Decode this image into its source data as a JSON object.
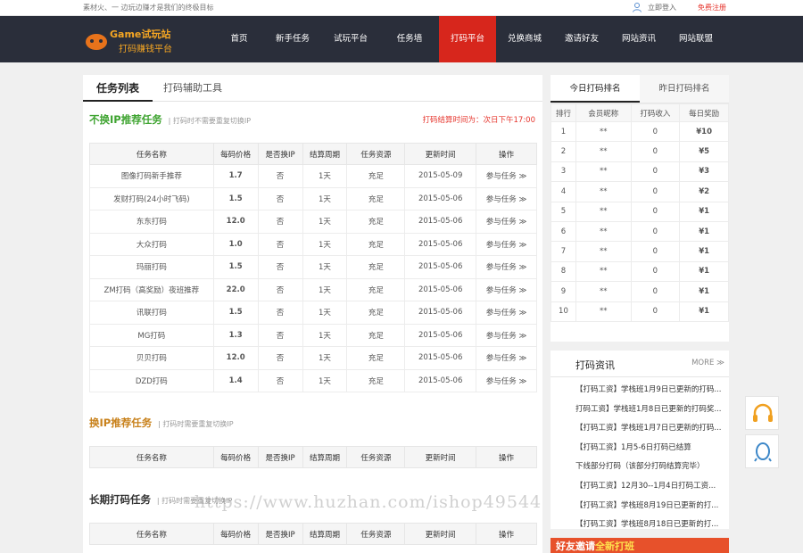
{
  "topbar": {
    "slogan": "素材火、一 边玩边赚才是我们的终极目标",
    "login": "立即登入",
    "register": "免费注册"
  },
  "logo": {
    "line1": "Game试玩站",
    "line2": "打码赚钱平台"
  },
  "nav": [
    {
      "label": "首页"
    },
    {
      "label": "新手任务"
    },
    {
      "label": "试玩平台"
    },
    {
      "label": "任务墙"
    },
    {
      "label": "打码平台",
      "active": true
    },
    {
      "label": "兑换商城"
    },
    {
      "label": "邀请好友"
    },
    {
      "label": "网站资讯"
    },
    {
      "label": "网站联盟"
    }
  ],
  "tabs": {
    "tab1": "任务列表",
    "tab2": "打码辅助工具"
  },
  "section1": {
    "title": "不换IP推荐任务",
    "note": "| 打码时不需要重复切换IP",
    "settle": "打码结算时间为：次日下午17:00"
  },
  "columns": [
    "任务名称",
    "每码价格",
    "是否换IP",
    "结算周期",
    "任务资源",
    "更新时间",
    "操作"
  ],
  "tasks": [
    {
      "name": "图像打码新手推荐",
      "price": "1.7",
      "ip": "否",
      "cycle": "1天",
      "res": "充足",
      "date": "2015-05-09",
      "op": "参与任务 ≫"
    },
    {
      "name": "发财打码(24小时飞码)",
      "price": "1.5",
      "ip": "否",
      "cycle": "1天",
      "res": "充足",
      "date": "2015-05-06",
      "op": "参与任务 ≫"
    },
    {
      "name": "东东打码",
      "price": "12.0",
      "ip": "否",
      "cycle": "1天",
      "res": "充足",
      "date": "2015-05-06",
      "op": "参与任务 ≫"
    },
    {
      "name": "大众打码",
      "price": "1.0",
      "ip": "否",
      "cycle": "1天",
      "res": "充足",
      "date": "2015-05-06",
      "op": "参与任务 ≫"
    },
    {
      "name": "玛丽打码",
      "price": "1.5",
      "ip": "否",
      "cycle": "1天",
      "res": "充足",
      "date": "2015-05-06",
      "op": "参与任务 ≫"
    },
    {
      "name": "ZM打码（高奖励）夜班推荐",
      "price": "22.0",
      "ip": "否",
      "cycle": "1天",
      "res": "充足",
      "date": "2015-05-06",
      "op": "参与任务 ≫"
    },
    {
      "name": "讯联打码",
      "price": "1.5",
      "ip": "否",
      "cycle": "1天",
      "res": "充足",
      "date": "2015-05-06",
      "op": "参与任务 ≫"
    },
    {
      "name": "MG打码",
      "price": "1.3",
      "ip": "否",
      "cycle": "1天",
      "res": "充足",
      "date": "2015-05-06",
      "op": "参与任务 ≫"
    },
    {
      "name": "贝贝打码",
      "price": "12.0",
      "ip": "否",
      "cycle": "1天",
      "res": "充足",
      "date": "2015-05-06",
      "op": "参与任务 ≫"
    },
    {
      "name": "DZD打码",
      "price": "1.4",
      "ip": "否",
      "cycle": "1天",
      "res": "充足",
      "date": "2015-05-06",
      "op": "参与任务 ≫"
    }
  ],
  "section2": {
    "title": "换IP推荐任务",
    "note": "| 打码时需要重复切换IP"
  },
  "section3": {
    "title": "长期打码任务",
    "note": "| 打码时需要重复切换IP"
  },
  "rank": {
    "tab1": "今日打码排名",
    "tab2": "昨日打码排名",
    "columns": [
      "排行",
      "会员昵称",
      "打码收入",
      "每日奖励"
    ],
    "rows": [
      {
        "no": "1",
        "name": "**",
        "income": "0",
        "prize": "¥10"
      },
      {
        "no": "2",
        "name": "**",
        "income": "0",
        "prize": "¥5"
      },
      {
        "no": "3",
        "name": "**",
        "income": "0",
        "prize": "¥3"
      },
      {
        "no": "4",
        "name": "**",
        "income": "0",
        "prize": "¥2"
      },
      {
        "no": "5",
        "name": "**",
        "income": "0",
        "prize": "¥1"
      },
      {
        "no": "6",
        "name": "**",
        "income": "0",
        "prize": "¥1"
      },
      {
        "no": "7",
        "name": "**",
        "income": "0",
        "prize": "¥1"
      },
      {
        "no": "8",
        "name": "**",
        "income": "0",
        "prize": "¥1"
      },
      {
        "no": "9",
        "name": "**",
        "income": "0",
        "prize": "¥1"
      },
      {
        "no": "10",
        "name": "**",
        "income": "0",
        "prize": "¥1"
      }
    ]
  },
  "news": {
    "title": "打码资讯",
    "more": "MORE ≫",
    "items": [
      "【打码工资】学栈班1月9日已更新的打码...",
      "打码工资】学栈班1月8日已更新的打码奖...",
      "【打码工资】学栈班1月7日已更新的打码...",
      "【打码工资】1月5-6日打码已结算",
      "下线部分打码（该部分打码结算完毕）",
      "【打码工资】12月30--1月4日打码工资...",
      "【打码工资】学栈班8月19日已更新的打...",
      "【打码工资】学栈班8月18日已更新的打..."
    ]
  },
  "banner": {
    "part1": "好友邀请",
    "part2": "全新打班"
  },
  "watermark": "https://www.huzhan.com/ishop49544",
  "colors": {
    "nav_bg": "#2a2e3a",
    "active": "#d7261c",
    "green": "#3fa431",
    "orange": "#c8811b",
    "price": "#e96c1b"
  }
}
